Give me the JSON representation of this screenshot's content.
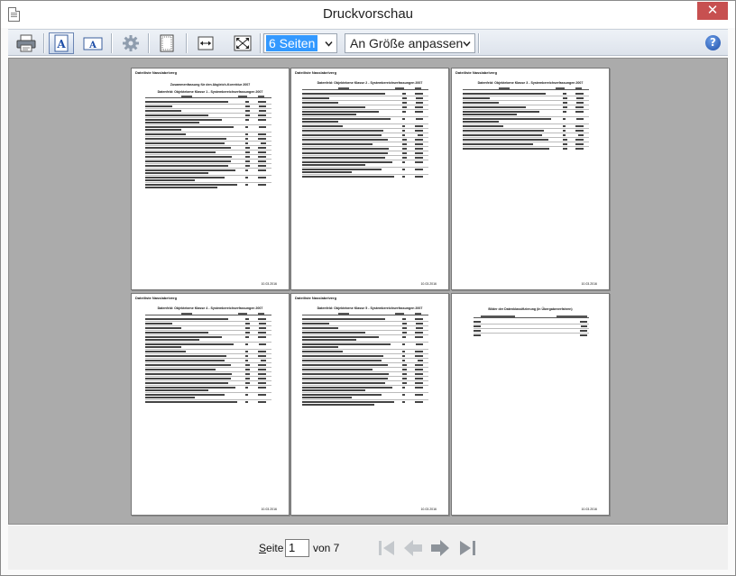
{
  "window": {
    "title": "Druckvorschau"
  },
  "toolbar": {
    "pages_select": "6 Seiten",
    "zoom_select": "An Größe anpassen"
  },
  "pages": [
    {
      "header": "Dateiliste Nasslabelverg",
      "titles": [
        "Zusammenfassung für den Abgleich-Korrektur 2007",
        "Datenfeld: Objektebene Klasse 1 - Systembereichserfassungen 2007"
      ],
      "date": "10.03.2016"
    },
    {
      "header": "Dateiliste Nasslabelverg",
      "titles": [
        "Datenfeld: Objektebene Klasse 2 - Systembereichserfassungen 2007"
      ],
      "date": "10.03.2016"
    },
    {
      "header": "Dateiliste Nasslabelverg",
      "titles": [
        "Datenfeld: Objektebene Klasse 3 - Systembereichserfassungen 2007"
      ],
      "date": "10.03.2016"
    },
    {
      "header": "Dateiliste Nasslabelverg",
      "titles": [
        "Datenfeld: Objektebene Klasse 4 - Systembereichserfassungen 2007"
      ],
      "date": "10.03.2016"
    },
    {
      "header": "Dateiliste Nasslabelverg",
      "titles": [
        "Datenfeld: Objektebene Klasse 5 - Systembereichserfassungen 2007"
      ],
      "date": "10.03.2016"
    },
    {
      "header": "Dateiliste Nasslabelverg",
      "titles": [
        "Bilder der Datenklassifizierung (in Übergabeverfahren)"
      ],
      "date": "10.03.2016"
    }
  ],
  "footer": {
    "page_label_u": "S",
    "page_label_rest": "eite",
    "page_value": "1",
    "of_label": "von 7"
  }
}
